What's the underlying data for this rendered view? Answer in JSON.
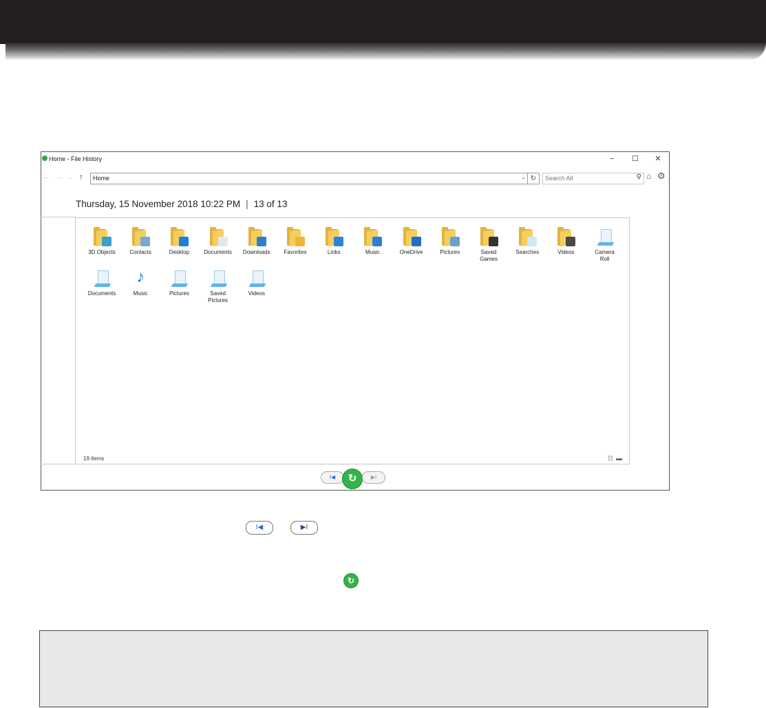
{
  "window": {
    "title": "Home - File History",
    "minimize": "−",
    "maximize": "☐",
    "close": "✕"
  },
  "nav": {
    "back": "←",
    "forward": "→",
    "recent": "⌄",
    "up": "↑",
    "address": "Home",
    "address_dropdown": "⌄",
    "refresh": "↻",
    "search_placeholder": "Search All",
    "search_icon": "⚲",
    "home_icon": "⌂",
    "settings_icon": "⚙"
  },
  "datebar": {
    "date": "Thursday, 15 November 2018 10:22 PM",
    "separator": "|",
    "position": "13 of 13"
  },
  "items_row1": [
    {
      "label": "3D Objects",
      "icon": "3d-objects-folder-icon",
      "badge_color": "#3aa0c9"
    },
    {
      "label": "Contacts",
      "icon": "contacts-folder-icon",
      "badge_color": "#7aa8d6"
    },
    {
      "label": "Desktop",
      "icon": "desktop-folder-icon",
      "badge_color": "#1f7fd8"
    },
    {
      "label": "Documents",
      "icon": "documents-folder-icon",
      "badge_color": "#dfe8f2"
    },
    {
      "label": "Downloads",
      "icon": "downloads-folder-icon",
      "badge_color": "#2d7fd6"
    },
    {
      "label": "Favorites",
      "icon": "favorites-folder-icon",
      "badge_color": "#f4b23a"
    },
    {
      "label": "Links",
      "icon": "links-folder-icon",
      "badge_color": "#2a87d8"
    },
    {
      "label": "Music",
      "icon": "music-folder-icon",
      "badge_color": "#2b7fd4"
    },
    {
      "label": "OneDrive",
      "icon": "onedrive-folder-icon",
      "badge_color": "#1d6fc7"
    },
    {
      "label": "Pictures",
      "icon": "pictures-folder-icon",
      "badge_color": "#6aa0cf"
    },
    {
      "label": "Saved\nGames",
      "icon": "saved-games-folder-icon",
      "badge_color": "#333333"
    },
    {
      "label": "Searches",
      "icon": "searches-folder-icon",
      "badge_color": "#cfe6f7"
    },
    {
      "label": "Videos",
      "icon": "videos-folder-icon",
      "badge_color": "#4a4a4a"
    },
    {
      "label": "Camera\nRoll",
      "icon": "camera-roll-library-icon",
      "badge_color": "#5fb4e8"
    }
  ],
  "items_row2": [
    {
      "label": "Documents",
      "icon": "documents-library-icon"
    },
    {
      "label": "Music",
      "icon": "music-library-icon"
    },
    {
      "label": "Pictures",
      "icon": "pictures-library-icon"
    },
    {
      "label": "Saved\nPictures",
      "icon": "saved-pictures-library-icon"
    },
    {
      "label": "Videos",
      "icon": "videos-library-icon"
    }
  ],
  "status": "19 items",
  "controls": {
    "prev": "I◀",
    "next": "▶I",
    "restore": "↻"
  }
}
